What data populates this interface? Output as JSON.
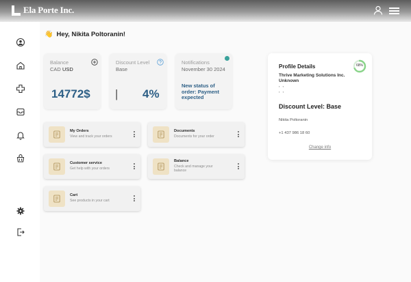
{
  "header": {
    "logo_text": "Ela Porte Inc.",
    "icons": [
      "user-icon",
      "hamburger-menu-icon"
    ]
  },
  "sidebar": {
    "items": [
      {
        "name": "profile",
        "icon": "user-circle-icon"
      },
      {
        "name": "home",
        "icon": "home-icon"
      },
      {
        "name": "products",
        "icon": "box-cross-icon"
      },
      {
        "name": "orders",
        "icon": "inbox-icon"
      },
      {
        "name": "notifications",
        "icon": "bell-icon"
      },
      {
        "name": "cart",
        "icon": "basket-icon"
      },
      {
        "name": "settings",
        "icon": "gear-icon"
      },
      {
        "name": "logout",
        "icon": "logout-icon"
      }
    ]
  },
  "greeting": {
    "emoji": "👋",
    "text": "Hey, Nikita Poltoranin!"
  },
  "stats": {
    "balance": {
      "label": "Balance",
      "currency_a": "CAD",
      "currency_b": "USD",
      "value": "14772$",
      "icon": "plus-circle-icon"
    },
    "discount": {
      "label": "Discount Level",
      "level": "Base",
      "bar": "|",
      "percent": "4%",
      "icon": "question-circle-icon"
    },
    "notifications": {
      "label": "Notifications",
      "date": "November 30 2024",
      "message": "New status of order: Payment expected",
      "dot_color": "#3aa29b"
    }
  },
  "tiles": [
    {
      "title": "My Orders",
      "desc": "View and track your orders",
      "icon": "document-icon"
    },
    {
      "title": "Documents",
      "desc": "Documents for your order",
      "icon": "document-icon"
    },
    {
      "title": "Customer service",
      "desc": "Get help with your orders",
      "icon": "document-icon"
    },
    {
      "title": "Balance",
      "desc": "Check and manage your balance",
      "icon": "document-icon"
    },
    {
      "title": "Cart",
      "desc": "See products in your cart",
      "icon": "document-icon"
    }
  ],
  "profile": {
    "title": "Profile Details",
    "progress_percent": 68,
    "progress_label": "68%",
    "company": "Thrive Marketing Solutions Inc.",
    "status": "Unknown",
    "dots_1": ", ,",
    "dots_2": ", ,",
    "discount_level": "Discount Level: Base",
    "name": "Nikita Poltoranin",
    "phone": "+1 437 986 18 60",
    "change_link": "Change info"
  },
  "colors": {
    "accent": "#2d5f86",
    "tile_icon_bg": "#efe2c5",
    "progress": "#8ad48a"
  }
}
